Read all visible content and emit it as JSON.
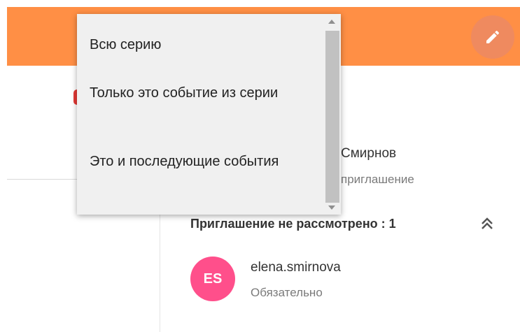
{
  "colors": {
    "header_accent": "#ff8f45",
    "edit_button": "#ef8a5f",
    "avatar_background": "#ff4f8b",
    "status_dot": "#e53935"
  },
  "header": {
    "edit_icon": "pencil-icon"
  },
  "dropdown": {
    "items": [
      {
        "label": "Всю серию"
      },
      {
        "label": "Только это событие из серии"
      },
      {
        "label": "Это и последующие события"
      }
    ],
    "scroll_up_icon": "chevron-up-icon",
    "scroll_down_icon": "chevron-down-icon"
  },
  "attendee": {
    "name_visible": "Смирнов",
    "status_visible": "приглашение"
  },
  "section": {
    "title": "Приглашение не рассмотрено : 1",
    "collapse_icon": "double-chevron-up-icon"
  },
  "member": {
    "initials": "ES",
    "name": "elena.smirnova",
    "role": "Обязательно"
  }
}
